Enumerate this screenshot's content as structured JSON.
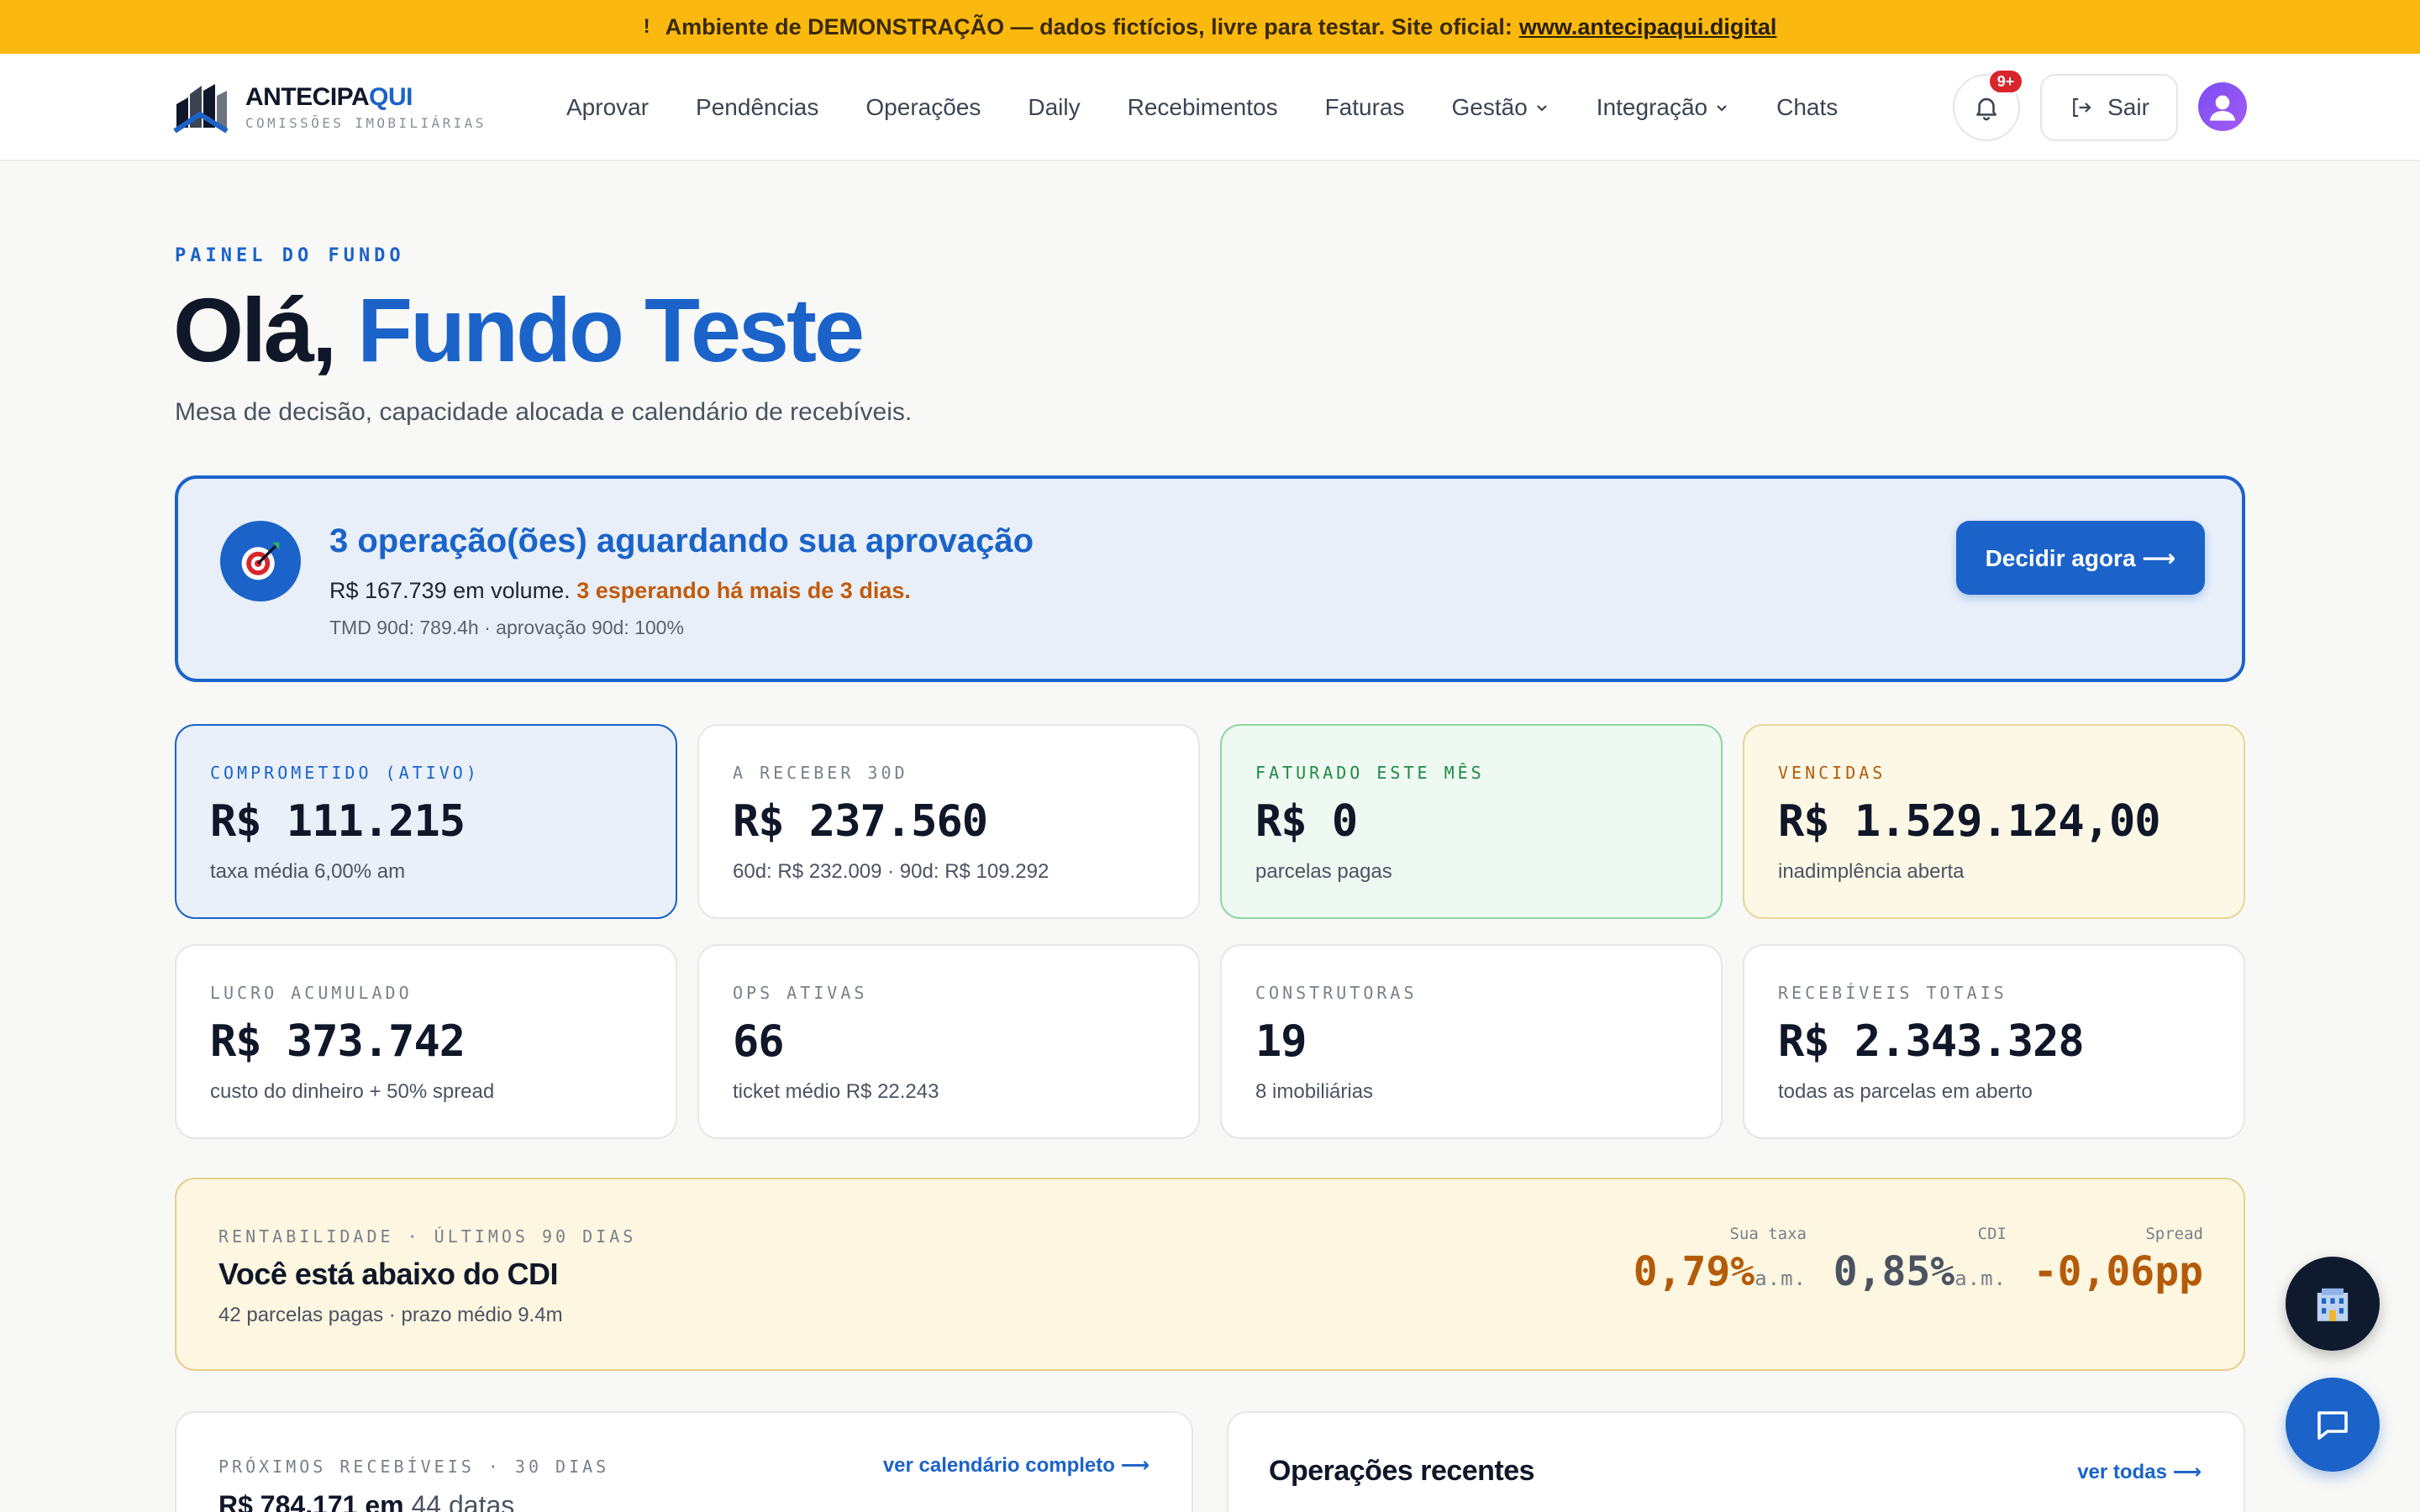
{
  "banner": {
    "icon": "warning-icon",
    "text": "Ambiente de DEMONSTRAÇÃO — dados fictícios, livre para testar. Site oficial:",
    "link": "www.antecipaqui.digital"
  },
  "brand": {
    "name_main": "ANTECIPA",
    "name_accent": "QUI",
    "tagline": "COMISSÕES IMOBILIÁRIAS",
    "accent_color": "#1b63c9"
  },
  "nav": {
    "items": [
      {
        "label": "Aprovar"
      },
      {
        "label": "Pendências"
      },
      {
        "label": "Operações"
      },
      {
        "label": "Daily"
      },
      {
        "label": "Recebimentos"
      },
      {
        "label": "Faturas"
      },
      {
        "label": "Gestão",
        "dropdown": true
      },
      {
        "label": "Integração",
        "dropdown": true
      },
      {
        "label": "Chats"
      }
    ],
    "notifications_badge": "9+",
    "logout_label": "Sair"
  },
  "hero": {
    "eyebrow": "PAINEL DO FUNDO",
    "greeting": "Olá,",
    "name": "Fundo Teste",
    "subtitle": "Mesa de decisão, capacidade alocada e calendário de recebíveis."
  },
  "alert": {
    "icon": "target-icon",
    "title": "3 operação(ões) aguardando sua aprovação",
    "body": "R$ 167.739 em volume.",
    "warning": "3 esperando há mais de 3 dias.",
    "meta": "TMD 90d: 789.4h · aprovação 90d: 100%",
    "button": "Decidir agora ⟶"
  },
  "stats": [
    {
      "label": "COMPROMETIDO (ATIVO)",
      "value": "R$ 111.215",
      "sub": "taxa média 6,00% am",
      "variant": "blue"
    },
    {
      "label": "A RECEBER 30D",
      "value": "R$ 237.560",
      "sub": "60d: R$ 232.009 · 90d: R$ 109.292",
      "variant": "plain"
    },
    {
      "label": "FATURADO ESTE MÊS",
      "value": "R$ 0",
      "sub": "parcelas pagas",
      "variant": "green"
    },
    {
      "label": "VENCIDAS",
      "value": "R$ 1.529.124,00",
      "sub": "inadimplência aberta",
      "variant": "amber"
    },
    {
      "label": "LUCRO ACUMULADO",
      "value": "R$ 373.742",
      "sub": "custo do dinheiro + 50% spread",
      "variant": "plain"
    },
    {
      "label": "OPS ATIVAS",
      "value": "66",
      "sub": "ticket médio R$ 22.243",
      "variant": "plain"
    },
    {
      "label": "CONSTRUTORAS",
      "value": "19",
      "sub": "8 imobiliárias",
      "variant": "plain"
    },
    {
      "label": "RECEBÍVEIS TOTAIS",
      "value": "R$ 2.343.328",
      "sub": "todas as parcelas em aberto",
      "variant": "plain"
    }
  ],
  "rentabilidade": {
    "label": "RENTABILIDADE · ÚLTIMOS 90 DIAS",
    "headline": "Você está abaixo do CDI",
    "sub": "42 parcelas pagas · prazo médio 9.4m",
    "metrics": [
      {
        "label": "Sua taxa",
        "value": "0,79%",
        "unit": "a.m.",
        "color": "#b45b0a"
      },
      {
        "label": "CDI",
        "value": "0,85%",
        "unit": "a.m.",
        "color": "#4b5362"
      },
      {
        "label": "Spread",
        "value": "-0,06pp",
        "unit": "",
        "color": "#b45b0a"
      }
    ]
  },
  "receivables": {
    "label": "PRÓXIMOS RECEBÍVEIS · 30 DIAS",
    "link": "ver calendário completo ⟶",
    "amount": "R$ 784.171 em",
    "dates": "44 datas"
  },
  "recent_ops": {
    "title": "Operações recentes",
    "link": "ver todas ⟶"
  }
}
